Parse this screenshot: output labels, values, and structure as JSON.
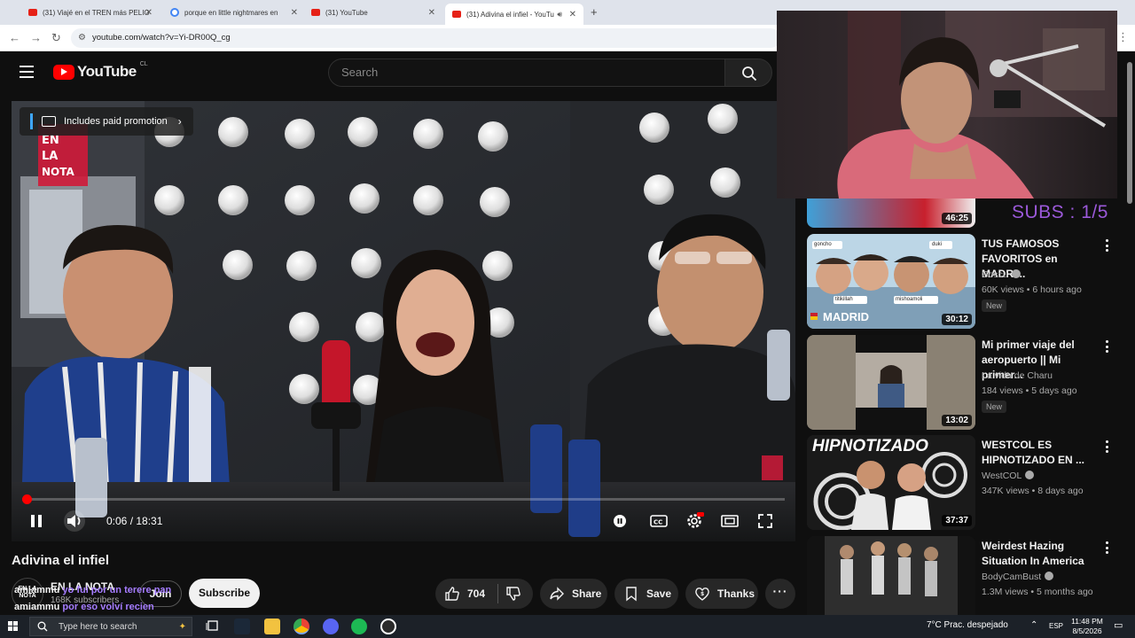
{
  "browser": {
    "tabs": [
      {
        "label": "(31) Viajé en el TREN más PELIG",
        "icon": "youtube-icon",
        "active": false
      },
      {
        "label": "porque en little nightmares en",
        "icon": "google-icon",
        "active": false
      },
      {
        "label": "(31) YouTube",
        "icon": "youtube-icon",
        "active": false
      },
      {
        "label": "(31) Adivina el infiel - YouTu",
        "icon": "youtube-icon",
        "active": true
      }
    ],
    "new_tab_label": "+",
    "url": "youtube.com/watch?v=Yi-DR00Q_cg"
  },
  "youtube": {
    "logo_text": "YouTube",
    "region": "CL",
    "search_placeholder": "Search"
  },
  "player": {
    "promo_label": "Includes paid promotion",
    "time_current": "0:06",
    "time_total": "18:31",
    "time_display": "0:06 / 18:31",
    "progress": 0.005
  },
  "video": {
    "title": "Adivina el infiel",
    "channel": "EN LA NOTA",
    "channel_avatar_text": "EN LA NOTA",
    "subscribers": "168K subscribers",
    "join_label": "Join",
    "subscribe_label": "Subscribe",
    "likes": "704",
    "share_label": "Share",
    "save_label": "Save",
    "thanks_label": "Thanks"
  },
  "stream_chat": [
    {
      "user": "amiammu",
      "message": "yo fui por un terere pan"
    },
    {
      "user": "amiammu",
      "message": "por eso volví recien"
    }
  ],
  "stream_overlay": {
    "subs_goal": "SUBS : 1/5"
  },
  "recommendations": [
    {
      "title": "",
      "channel": "",
      "views": "",
      "duration": "46:25",
      "partial": true
    },
    {
      "title": "TUS FAMOSOS FAVORITOS en MADRI...",
      "channel": "Coscu",
      "verified": true,
      "views": "60K views • 6 hours ago",
      "badge": "New",
      "duration": "30:12",
      "thumb_text": "MADRID",
      "thumb_tags": [
        "goncho",
        "duki",
        "titikillah",
        "mishoamoli"
      ]
    },
    {
      "title": "Mi primer viaje del aeropuerto || Mi primer...",
      "channel": "La vida de Charu",
      "verified": false,
      "views": "184 views • 5 days ago",
      "badge": "New",
      "duration": "13:02"
    },
    {
      "title": "WESTCOL ES HIPNOTIZADO EN ...",
      "channel": "WestCOL",
      "verified": true,
      "views": "347K views • 8 days ago",
      "badge": "",
      "duration": "37:37",
      "thumb_text": "HIPNOTIZADO"
    },
    {
      "title": "Weirdest Hazing Situation In America",
      "channel": "BodyCamBust",
      "verified": true,
      "views": "1.3M views • 5 months ago",
      "badge": "",
      "duration": ""
    }
  ],
  "taskbar": {
    "search_placeholder": "Type here to search",
    "weather": "7°C  Prac. despejado",
    "language": "ESP",
    "time": "11:48 PM",
    "date": "8/5/2026"
  },
  "colors": {
    "yt_red": "#ff0000",
    "bg": "#0f0f0f",
    "chat_purple": "#a57cff",
    "subs_purple": "#9b59d9"
  }
}
